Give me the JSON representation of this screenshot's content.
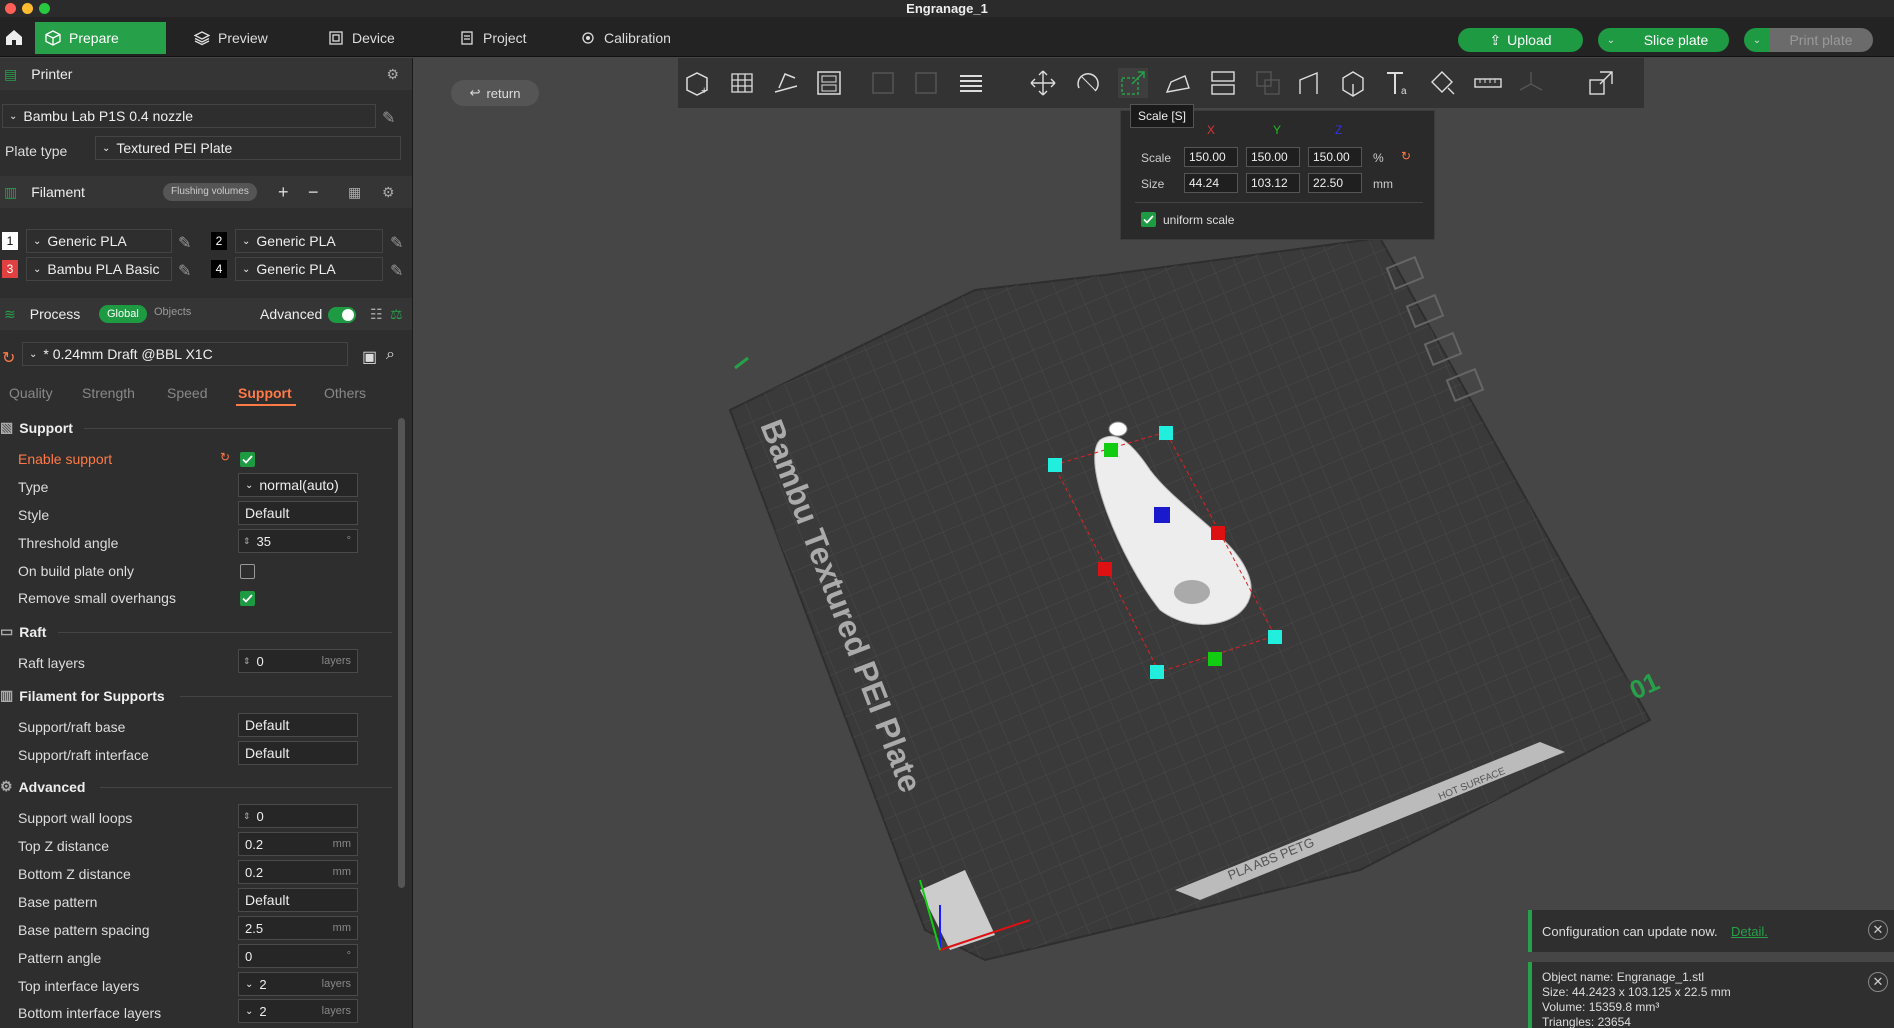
{
  "window": {
    "title": "Engranage_1"
  },
  "nav": {
    "tabs": [
      {
        "label": "Prepare"
      },
      {
        "label": "Preview"
      },
      {
        "label": "Device"
      },
      {
        "label": "Project"
      },
      {
        "label": "Calibration"
      }
    ],
    "upload": "Upload",
    "slice": "Slice plate",
    "print": "Print plate"
  },
  "printer": {
    "header": "Printer",
    "name": "Bambu Lab P1S 0.4 nozzle",
    "plate_label": "Plate type",
    "plate_value": "Textured PEI Plate"
  },
  "filament": {
    "header": "Filament",
    "flushing": "Flushing volumes",
    "slots": [
      {
        "num": "1",
        "name": "Generic PLA",
        "color": "#ffffff"
      },
      {
        "num": "2",
        "name": "Generic PLA",
        "color": "#000000"
      },
      {
        "num": "3",
        "name": "Bambu PLA Basic",
        "color": "#e04040"
      },
      {
        "num": "4",
        "name": "Generic PLA",
        "color": "#000000"
      }
    ]
  },
  "process": {
    "header": "Process",
    "global": "Global",
    "objects": "Objects",
    "advanced_label": "Advanced",
    "preset": "* 0.24mm Draft @BBL X1C",
    "tabs": [
      "Quality",
      "Strength",
      "Speed",
      "Support",
      "Others"
    ],
    "active_tab": "Support"
  },
  "support": {
    "group_support": "Support",
    "enable_label": "Enable support",
    "enable_on": true,
    "type_label": "Type",
    "type_value": "normal(auto)",
    "style_label": "Style",
    "style_value": "Default",
    "threshold_label": "Threshold angle",
    "threshold_value": "35",
    "threshold_unit": "°",
    "onplate_label": "On build plate only",
    "onplate_on": false,
    "remove_label": "Remove small overhangs",
    "remove_on": true,
    "group_raft": "Raft",
    "raft_label": "Raft layers",
    "raft_value": "0",
    "raft_unit": "layers",
    "group_fil": "Filament for Supports",
    "base_label": "Support/raft base",
    "base_value": "Default",
    "iface_label": "Support/raft interface",
    "iface_value": "Default",
    "group_adv": "Advanced",
    "wall_label": "Support wall loops",
    "wall_value": "0",
    "topz_label": "Top Z distance",
    "topz_value": "0.2",
    "mm": "mm",
    "botz_label": "Bottom Z distance",
    "botz_value": "0.2",
    "bpat_label": "Base pattern",
    "bpat_value": "Default",
    "bspc_label": "Base pattern spacing",
    "bspc_value": "2.5",
    "pang_label": "Pattern angle",
    "pang_value": "0",
    "pang_unit": "°",
    "til_label": "Top interface layers",
    "til_value": "2",
    "layers": "layers",
    "bil_label": "Bottom interface layers",
    "bil_value": "2"
  },
  "viewport": {
    "return": "return",
    "plate_text": "Bambu Textured PEI Plate",
    "plate_number": "01",
    "plate_strip": "PLA ABS PETG",
    "plate_hot": "HOT SURFACE"
  },
  "scale_popup": {
    "tooltip": "Scale [S]",
    "x": "X",
    "y": "Y",
    "z": "Z",
    "scale_label": "Scale",
    "sx": "150.00",
    "sy": "150.00",
    "sz": "150.00",
    "pct": "%",
    "size_label": "Size",
    "wx": "44.24",
    "wy": "103.12",
    "wz": "22.50",
    "mm": "mm",
    "uniform": "uniform scale"
  },
  "notifications": {
    "update": "Configuration can update now.",
    "detail": "Detail.",
    "obj_name": "Object name: Engranage_1.stl",
    "obj_size": "Size: 44.2423 x 103.125 x 22.5 mm",
    "obj_volume": "Volume: 15359.8 mm³",
    "obj_tris": "Triangles: 23654"
  },
  "colors": {
    "accent": "#1e9a43",
    "support_tab": "#ff7a45",
    "enable_label": "#ff7a45"
  }
}
